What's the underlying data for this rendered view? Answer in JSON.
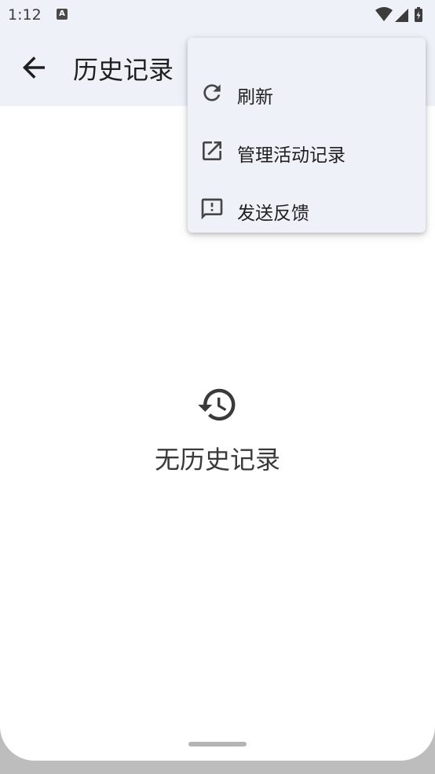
{
  "status_bar": {
    "time": "1:12",
    "notification_badge": "A",
    "icons": [
      "wifi-icon",
      "signal-icon",
      "battery-icon"
    ]
  },
  "app_bar": {
    "title": "历史记录",
    "back_icon": "arrow-left-icon"
  },
  "empty_state": {
    "icon": "history-icon",
    "message": "无历史记录"
  },
  "overflow_menu": {
    "items": [
      {
        "label": "刷新",
        "icon": "refresh-icon"
      },
      {
        "label": "管理活动记录",
        "icon": "open-external-icon"
      },
      {
        "label": "发送反馈",
        "icon": "feedback-icon"
      }
    ]
  },
  "colors": {
    "app_bar_background": "#eef1f7",
    "menu_background": "#eef2f8",
    "text_primary": "#1f1f1f",
    "icon": "#444746"
  }
}
